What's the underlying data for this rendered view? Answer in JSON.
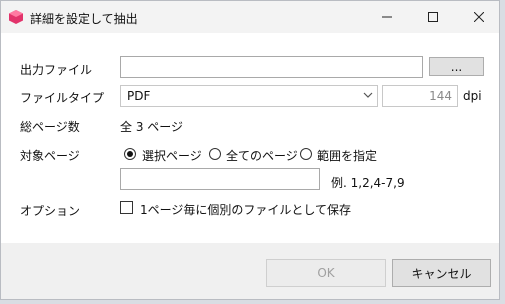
{
  "window": {
    "title": "詳細を設定して抽出",
    "minimize_icon": "minimize-icon",
    "maximize_icon": "maximize-icon",
    "close_icon": "close-icon"
  },
  "form": {
    "output_file": {
      "label": "出力ファイル",
      "value": "",
      "browse_label": "..."
    },
    "file_type": {
      "label": "ファイルタイプ",
      "selected": "PDF",
      "dpi_value": "144",
      "dpi_unit": "dpi"
    },
    "total_pages": {
      "label": "総ページ数",
      "value": "全 3 ページ"
    },
    "target_pages": {
      "label": "対象ページ",
      "options": [
        {
          "label": "選択ページ",
          "selected": true
        },
        {
          "label": "全てのページ",
          "selected": false
        },
        {
          "label": "範囲を指定",
          "selected": false
        }
      ],
      "range_value": "",
      "range_example": "例. 1,2,4-7,9"
    },
    "options": {
      "label": "オプション",
      "checkbox_label": "1ページ毎に個別のファイルとして保存",
      "checked": false
    }
  },
  "footer": {
    "ok_label": "OK",
    "cancel_label": "キャンセル"
  },
  "colors": {
    "window_bg": "#f0f0f0",
    "content_bg": "#ffffff",
    "button_bg": "#e1e1e1",
    "disabled_text": "#a0a0a0"
  }
}
